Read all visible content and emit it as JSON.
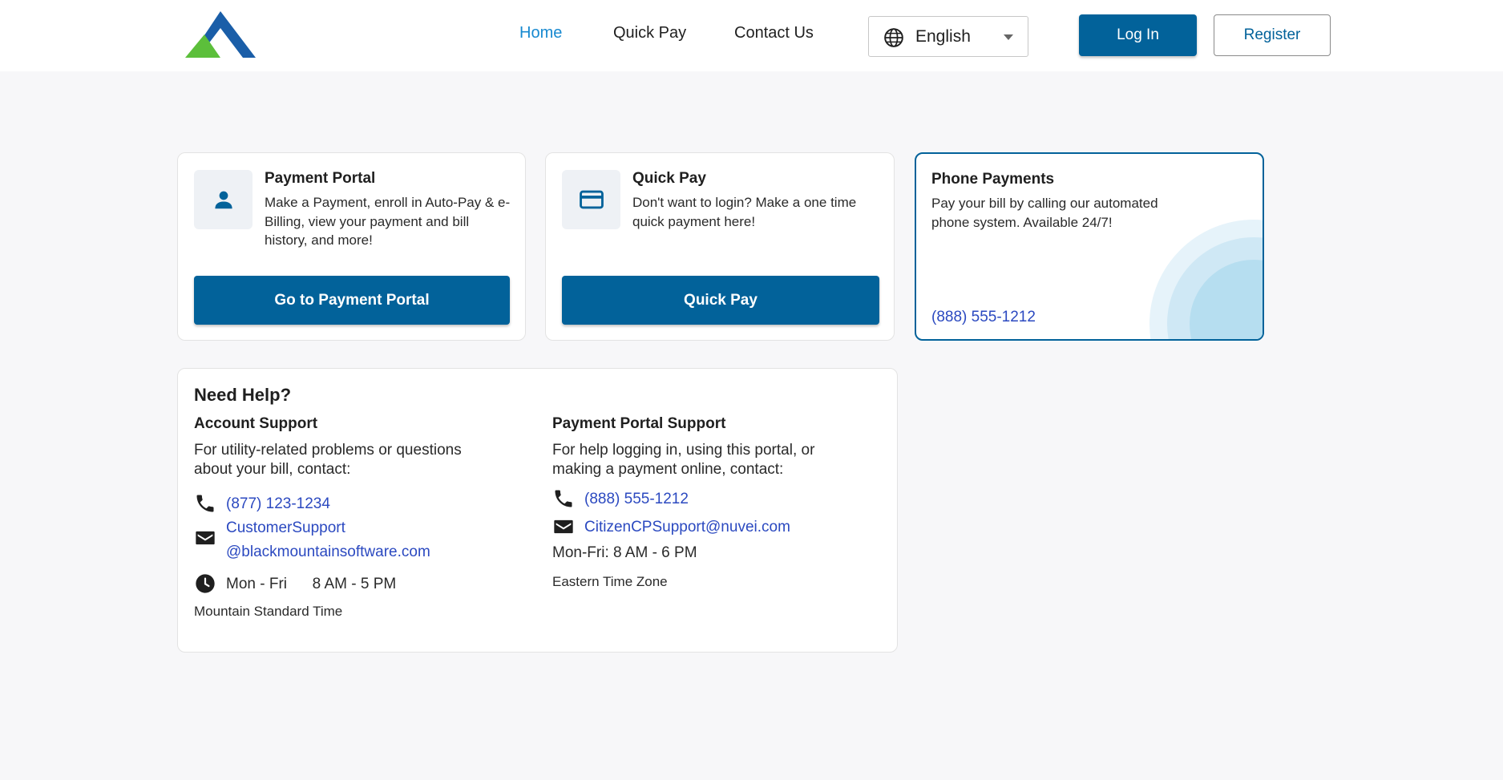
{
  "header": {
    "nav": [
      {
        "label": "Home",
        "active": true
      },
      {
        "label": "Quick Pay",
        "active": false
      },
      {
        "label": "Contact Us",
        "active": false
      }
    ],
    "language": {
      "selected": "English",
      "icon": "globe-icon"
    },
    "login_label": "Log In",
    "register_label": "Register"
  },
  "cards": {
    "payment_portal": {
      "icon": "person-icon",
      "title": "Payment Portal",
      "description": "Make a Payment, enroll in Auto-Pay & e-Billing, view your payment and bill history, and more!",
      "button_label": "Go to Payment Portal"
    },
    "quick_pay": {
      "icon": "credit-card-icon",
      "title": "Quick Pay",
      "description": "Don't want to login? Make a one time quick payment here!",
      "button_label": "Quick Pay"
    },
    "phone_payments": {
      "title": "Phone Payments",
      "description": "Pay your bill by calling our automated phone system. Available 24/7!",
      "phone": "(888) 555-1212"
    }
  },
  "help": {
    "title": "Need Help?",
    "account_support": {
      "title": "Account Support",
      "description": "For utility-related problems or questions about your bill, contact:",
      "phone": "(877) 123-1234",
      "email_line1": "CustomerSupport",
      "email_line2": "@blackmountainsoftware.com",
      "hours": "Mon - Fri      8 AM - 5 PM",
      "timezone": "Mountain Standard Time"
    },
    "portal_support": {
      "title": "Payment Portal Support",
      "description": "For help logging in, using this portal, or making a payment online, contact:",
      "phone": "(888) 555-1212",
      "email": "CitizenCPSupport@nuvei.com",
      "hours": "Mon-Fri: 8 AM - 6 PM",
      "timezone": "Eastern Time Zone"
    }
  },
  "colors": {
    "primary": "#02629a",
    "link": "#2b49c0",
    "nav_active": "#1789d0",
    "logo_blue": "#1a5ea8",
    "logo_green": "#5cbf3b"
  }
}
